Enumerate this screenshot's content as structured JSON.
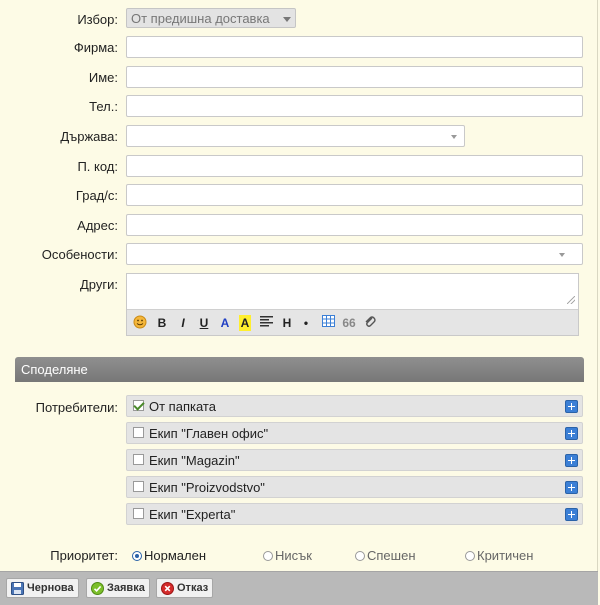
{
  "form": {
    "izbor": {
      "label": "Избор:",
      "value": "От предишна доставка"
    },
    "firma": {
      "label": "Фирма:",
      "value": ""
    },
    "ime": {
      "label": "Име:",
      "value": ""
    },
    "tel": {
      "label": "Тел.:",
      "value": ""
    },
    "darzhava": {
      "label": "Държава:",
      "value": ""
    },
    "pkod": {
      "label": "П. код:",
      "value": ""
    },
    "grad": {
      "label": "Град/с:",
      "value": ""
    },
    "adres": {
      "label": "Адрес:",
      "value": ""
    },
    "osobenosti": {
      "label": "Особености:",
      "value": ""
    },
    "drugi": {
      "label": "Други:",
      "value": ""
    }
  },
  "toolbar": {
    "bold": "B",
    "italic": "I",
    "underline": "U",
    "color": "A",
    "highlight": "A",
    "heading": "H",
    "bullet": "•",
    "quote": "66",
    "icons": [
      "smiley-icon",
      "bold-icon",
      "italic-icon",
      "underline-icon",
      "font-color-icon",
      "highlight-icon",
      "align-icon",
      "heading-icon",
      "bullet-icon",
      "table-icon",
      "quote-icon",
      "attach-icon"
    ]
  },
  "sharing": {
    "title": "Споделяне",
    "users_label": "Потребители:",
    "users": [
      {
        "label": "От папката",
        "checked": true
      },
      {
        "label": "Екип \"Главен офис\"",
        "checked": false
      },
      {
        "label": "Екип \"Magazin\"",
        "checked": false
      },
      {
        "label": "Екип \"Proizvodstvo\"",
        "checked": false
      },
      {
        "label": "Екип \"Experta\"",
        "checked": false
      }
    ]
  },
  "priority": {
    "label": "Приоритет:",
    "options": [
      "Нормален",
      "Нисък",
      "Спешен",
      "Критичен"
    ],
    "selected": "Нормален"
  },
  "footer": {
    "draft": "Чернова",
    "submit": "Заявка",
    "cancel": "Отказ"
  },
  "colors": {
    "accent": "#3b7fd6",
    "background": "#fdfbe6",
    "section_bar": "#808080"
  }
}
